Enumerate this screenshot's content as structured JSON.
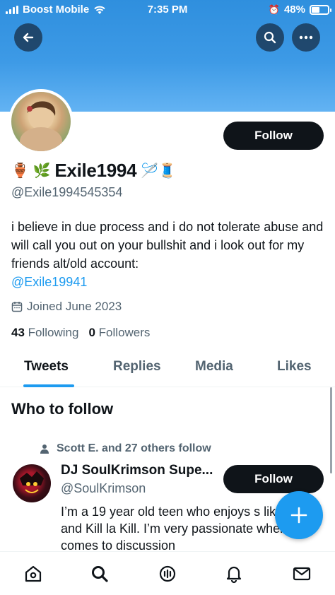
{
  "status_bar": {
    "carrier": "Boost Mobile",
    "time": "7:35 PM",
    "battery": "48%",
    "battery_level": 0.48
  },
  "header": {
    "back_icon": "arrow-left-icon",
    "search_icon": "search-icon",
    "more_icon": "more-horizontal-icon"
  },
  "profile": {
    "follow_label": "Follow",
    "name_emoji_left": "🏺 🌿",
    "display_name": "Exile1994",
    "name_emoji_right": "🪡🧵",
    "handle": "@Exile1994545354",
    "bio_text": "i believe in due process and i do not tolerate abuse and will call you out on your bullshit and i look out for my friends alt/old account:",
    "bio_mention": "@Exile19941",
    "joined": "Joined June 2023",
    "following_count": "43",
    "following_label": "Following",
    "followers_count": "0",
    "followers_label": "Followers"
  },
  "tabs": [
    "Tweets",
    "Replies",
    "Media",
    "Likes"
  ],
  "who_to_follow": {
    "title": "Who to follow",
    "social_context": "Scott E. and 27 others follow",
    "suggestion": {
      "name": "DJ SoulKrimson Supe...",
      "handle": "@SoulKrimson",
      "bio": "I’m a 19 year old teen who enjoys s like MHA and Kill la Kill. I’m very passionate when it comes to discussion",
      "follow_label": "Follow"
    }
  },
  "bottom_nav": [
    "home-icon",
    "search-icon",
    "spaces-icon",
    "notifications-icon",
    "messages-icon"
  ],
  "colors": {
    "accent": "#1d9bf0",
    "banner": "#3d9ae6",
    "button": "#0f1419",
    "secondary_text": "#536471"
  }
}
